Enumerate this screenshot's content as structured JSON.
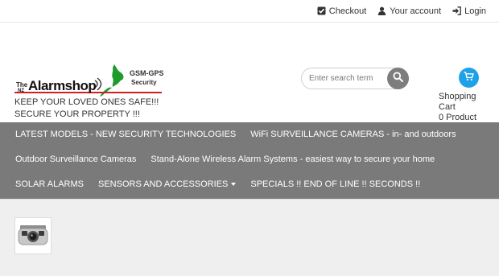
{
  "topbar": {
    "checkout": "Checkout",
    "account": "Your account",
    "login": "Login"
  },
  "logo": {
    "the": "The",
    "nz": "NZ",
    "name": "Alarmshop",
    "gsm": "GSM-GPS",
    "security": "Security"
  },
  "tagline": "KEEP YOUR LOVED ONES SAFE!!! SECURE YOUR PROPERTY !!!",
  "search": {
    "placeholder": "Enter search term"
  },
  "cart": {
    "label": "Shopping Cart",
    "count": "0 Product"
  },
  "nav": {
    "items": [
      {
        "label": "LATEST MODELS - NEW SECURITY TECHNOLOGIES"
      },
      {
        "label": "WiFi SURVEILLANCE CAMERAS - in- and outdoors"
      },
      {
        "label": "Outdoor Surveillance Cameras"
      },
      {
        "label": "Stand-Alone Wireless Alarm Systems - easiest way to secure your home"
      },
      {
        "label": "SOLAR ALARMS"
      },
      {
        "label": "SENSORS AND ACCESSORIES"
      },
      {
        "label": "SPECIALS !! END OF LINE !! SECONDS !!"
      }
    ]
  },
  "colors": {
    "nav_bg": "#7a7a7a",
    "cart_accent": "#1ea1e8",
    "logo_green": "#1f9b2b",
    "logo_red": "#d21f1f"
  }
}
